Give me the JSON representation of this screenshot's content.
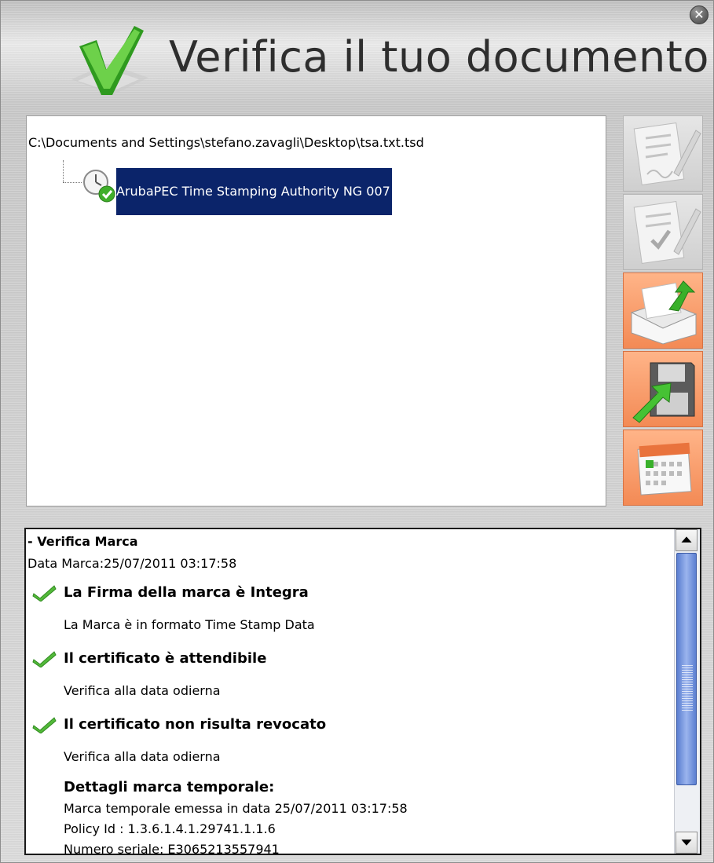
{
  "app": {
    "title": "Verifica il tuo documento",
    "close_glyph": "✕",
    "accent_color": "#f38a55"
  },
  "tree": {
    "file_path": "C:\\Documents and Settings\\stefano.zavagli\\Desktop\\tsa.txt.tsd",
    "nodes": [
      {
        "label": "ArubaPEC Time Stamping Authority NG 007",
        "icon": "clock-check-icon",
        "selected": true
      }
    ]
  },
  "sidebar_buttons": [
    {
      "name": "sign-document-button",
      "icon": "document-pen-icon",
      "enabled": false
    },
    {
      "name": "verify-signature-button",
      "icon": "document-check-pen-icon",
      "enabled": false
    },
    {
      "name": "send-mail-button",
      "icon": "envelope-arrow-icon",
      "enabled": true
    },
    {
      "name": "save-document-button",
      "icon": "floppy-arrow-icon",
      "enabled": true
    },
    {
      "name": "calendar-button",
      "icon": "calendar-icon",
      "enabled": true
    }
  ],
  "details": {
    "section_title": "- Verifica Marca",
    "date_line": "Data Marca:25/07/2011 03:17:58",
    "checks": [
      {
        "title": "La Firma della marca è Integra",
        "note": "La Marca è in formato Time Stamp Data"
      },
      {
        "title": "Il certificato è attendibile",
        "note": "Verifica alla data odierna"
      },
      {
        "title": "Il certificato non risulta revocato",
        "note": "Verifica alla data odierna"
      }
    ],
    "timestamp_details": {
      "heading": "Dettagli marca temporale:",
      "lines": [
        "Marca temporale emessa in data 25/07/2011 03:17:58",
        "Policy Id : 1.3.6.1.4.1.29741.1.1.6",
        "Numero seriale: E3065213557941"
      ]
    }
  },
  "scrollbar": {
    "up": "▲",
    "down": "▼"
  }
}
